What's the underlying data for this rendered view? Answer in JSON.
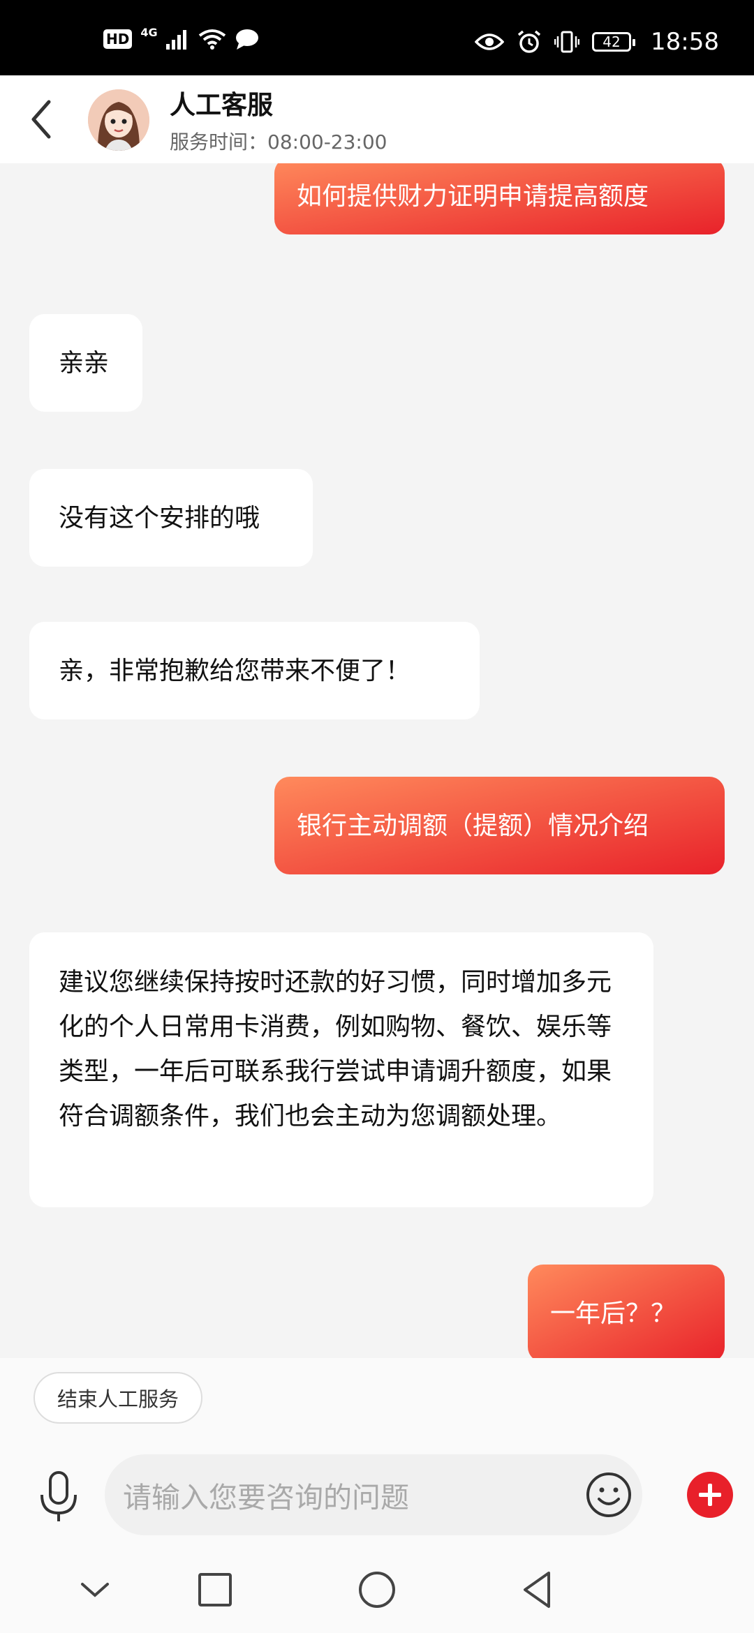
{
  "status_bar": {
    "left_badges": [
      "HD",
      "4G"
    ],
    "battery": "42",
    "time": "18:58"
  },
  "header": {
    "title": "人工客服",
    "service_hours": "服务时间：08:00-23:00"
  },
  "messages": [
    {
      "sender": "user",
      "text": "如何提供财力证明申请提高额度"
    },
    {
      "sender": "agent",
      "text": "亲亲"
    },
    {
      "sender": "agent",
      "text": "没有这个安排的哦"
    },
    {
      "sender": "agent",
      "text": "亲，非常抱歉给您带来不便了！"
    },
    {
      "sender": "user",
      "text": "银行主动调额（提额）情况介绍"
    },
    {
      "sender": "agent",
      "text": "建议您继续保持按时还款的好习惯，同时增加多元化的个人日常用卡消费，例如购物、餐饮、娱乐等类型，一年后可联系我行尝试申请调升额度，如果符合调额条件，我们也会主动为您调额处理。"
    },
    {
      "sender": "user",
      "text": "一年后？？"
    }
  ],
  "bottom": {
    "end_service_label": "结束人工服务",
    "input_placeholder": "请输入您要咨询的问题"
  },
  "colors": {
    "accent": "#e8222a",
    "bubble_gradient_start": "#ff8a5c",
    "background": "#f4f4f4"
  },
  "icons": [
    "back-arrow-icon",
    "mic-icon",
    "emoji-icon",
    "plus-icon",
    "nav-down-icon",
    "nav-square-icon",
    "nav-circle-icon",
    "nav-back-icon"
  ]
}
